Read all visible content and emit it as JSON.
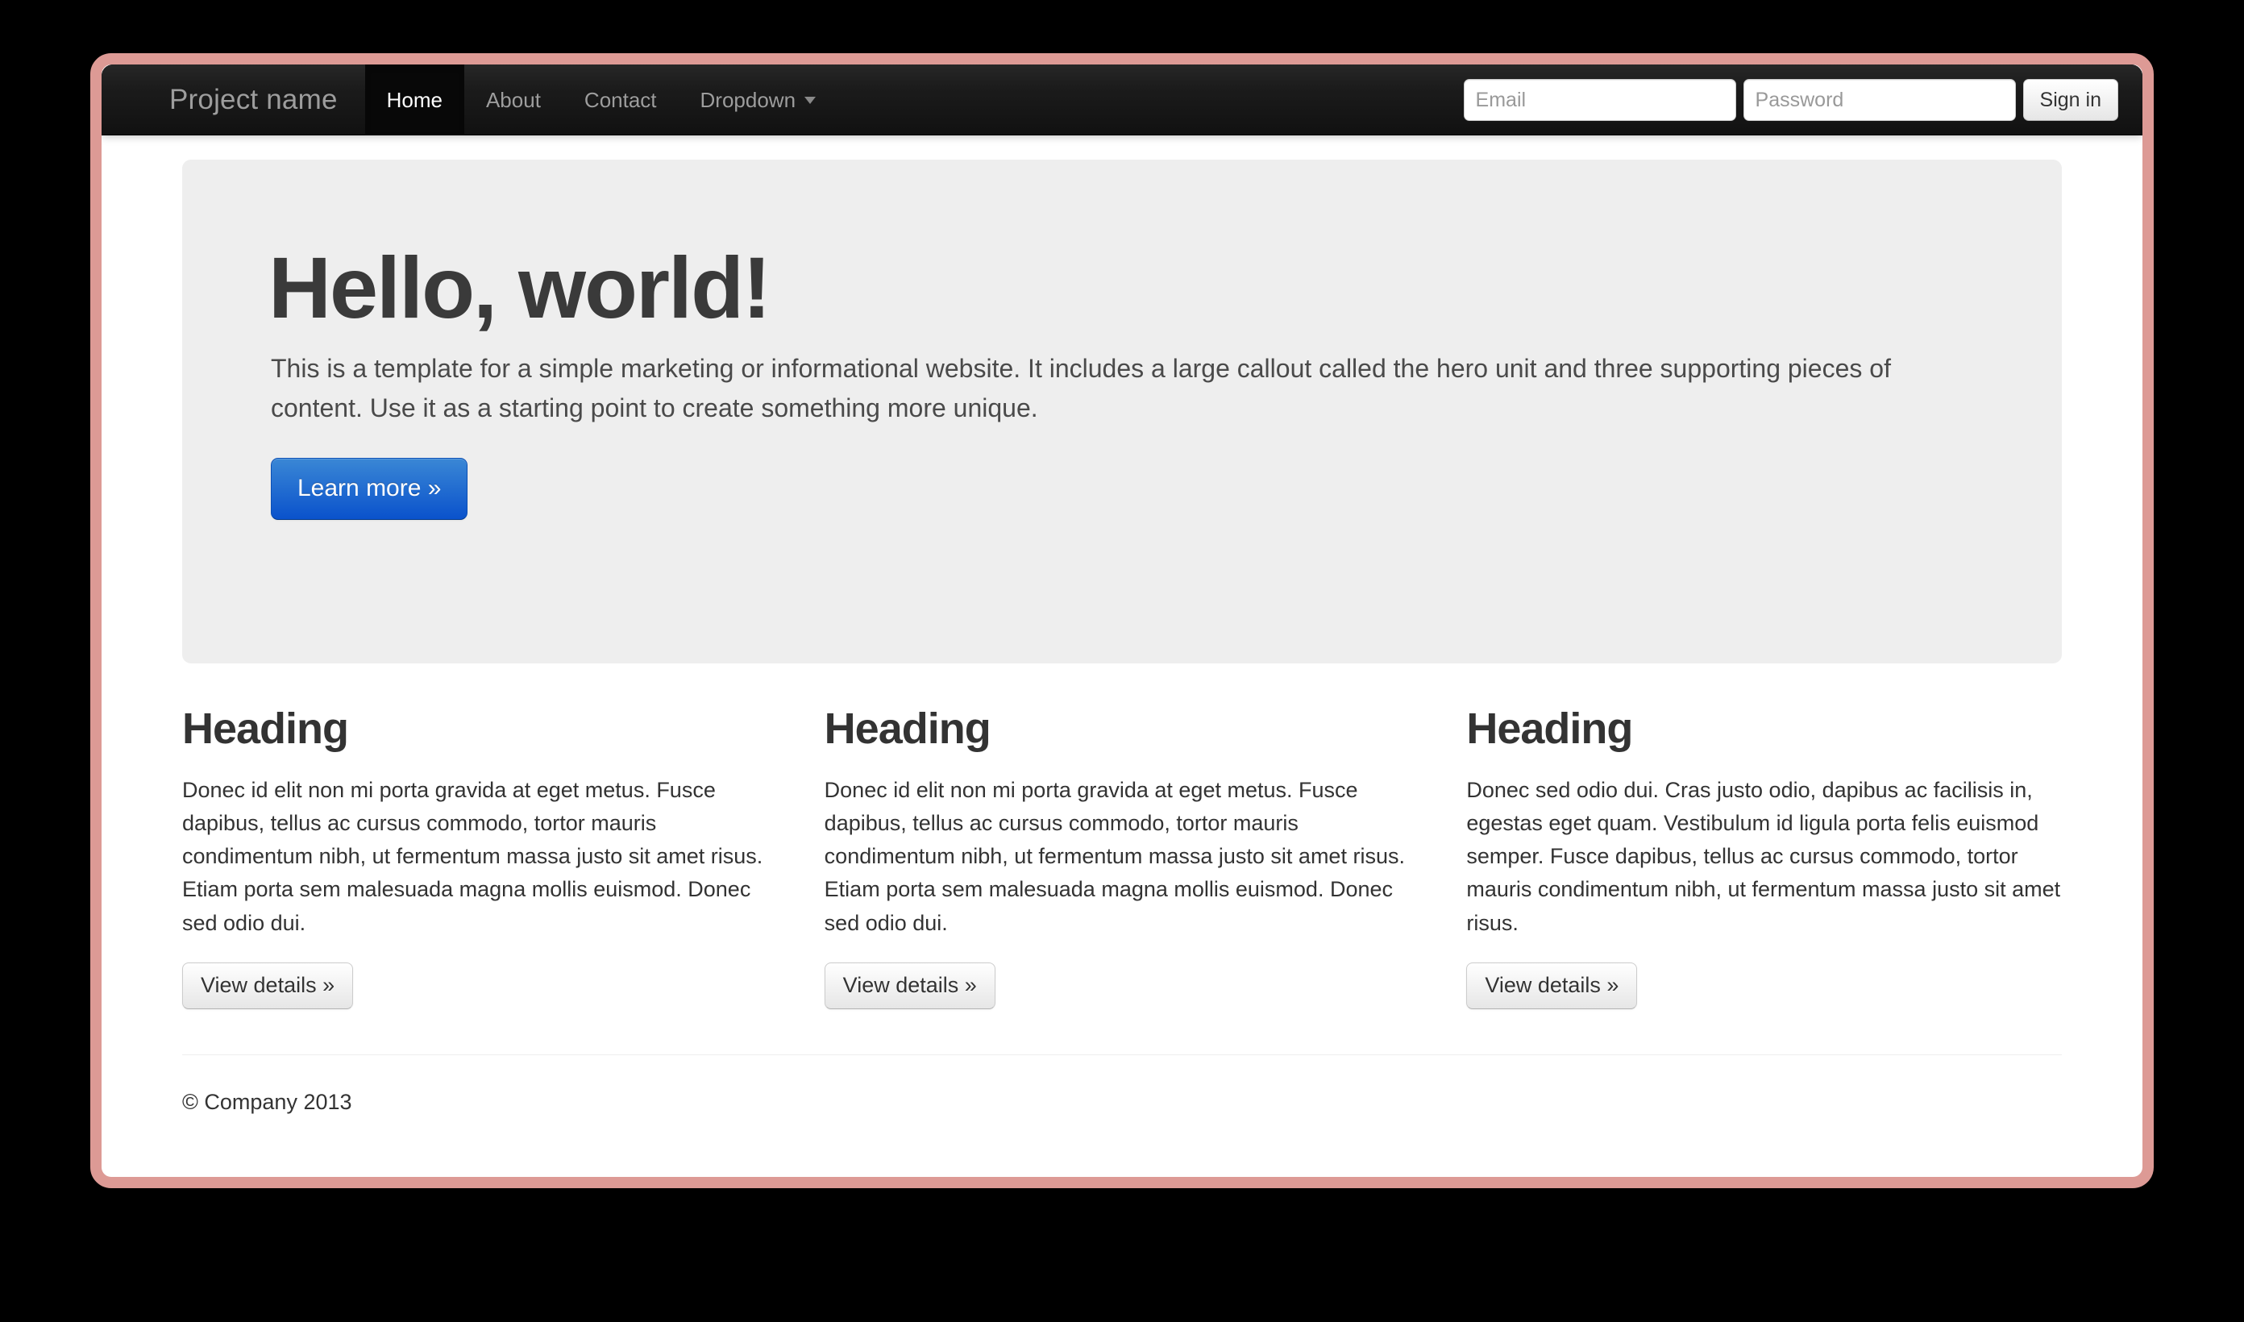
{
  "theme": {
    "frame_border_color": "#dd9a95",
    "page_background": "#000000",
    "navbar_background": "#1b1b1b",
    "navbar_active_background": "#080808",
    "navbar_link_color": "#9d9d9d",
    "hero_background": "#eeeeee",
    "primary_button_color": "#0a52cc"
  },
  "navbar": {
    "brand": "Project name",
    "items": [
      {
        "label": "Home",
        "active": true,
        "has_caret": false
      },
      {
        "label": "About",
        "active": false,
        "has_caret": false
      },
      {
        "label": "Contact",
        "active": false,
        "has_caret": false
      },
      {
        "label": "Dropdown",
        "active": false,
        "has_caret": true
      }
    ],
    "form": {
      "email_value": "",
      "email_placeholder": "Email",
      "password_value": "",
      "password_placeholder": "Password",
      "signin_label": "Sign in"
    }
  },
  "hero": {
    "title": "Hello, world!",
    "body": "This is a template for a simple marketing or informational website. It includes a large callout called the hero unit and three supporting pieces of content. Use it as a starting point to create something more unique.",
    "cta_label": "Learn more »"
  },
  "columns": [
    {
      "heading": "Heading",
      "body": "Donec id elit non mi porta gravida at eget metus. Fusce dapibus, tellus ac cursus commodo, tortor mauris condimentum nibh, ut fermentum massa justo sit amet risus. Etiam porta sem malesuada magna mollis euismod. Donec sed odio dui.",
      "button_label": "View details »"
    },
    {
      "heading": "Heading",
      "body": "Donec id elit non mi porta gravida at eget metus. Fusce dapibus, tellus ac cursus commodo, tortor mauris condimentum nibh, ut fermentum massa justo sit amet risus. Etiam porta sem malesuada magna mollis euismod. Donec sed odio dui.",
      "button_label": "View details »"
    },
    {
      "heading": "Heading",
      "body": "Donec sed odio dui. Cras justo odio, dapibus ac facilisis in, egestas eget quam. Vestibulum id ligula porta felis euismod semper. Fusce dapibus, tellus ac cursus commodo, tortor mauris condimentum nibh, ut fermentum massa justo sit amet risus.",
      "button_label": "View details »"
    }
  ],
  "footer": {
    "copyright": "© Company 2013"
  }
}
